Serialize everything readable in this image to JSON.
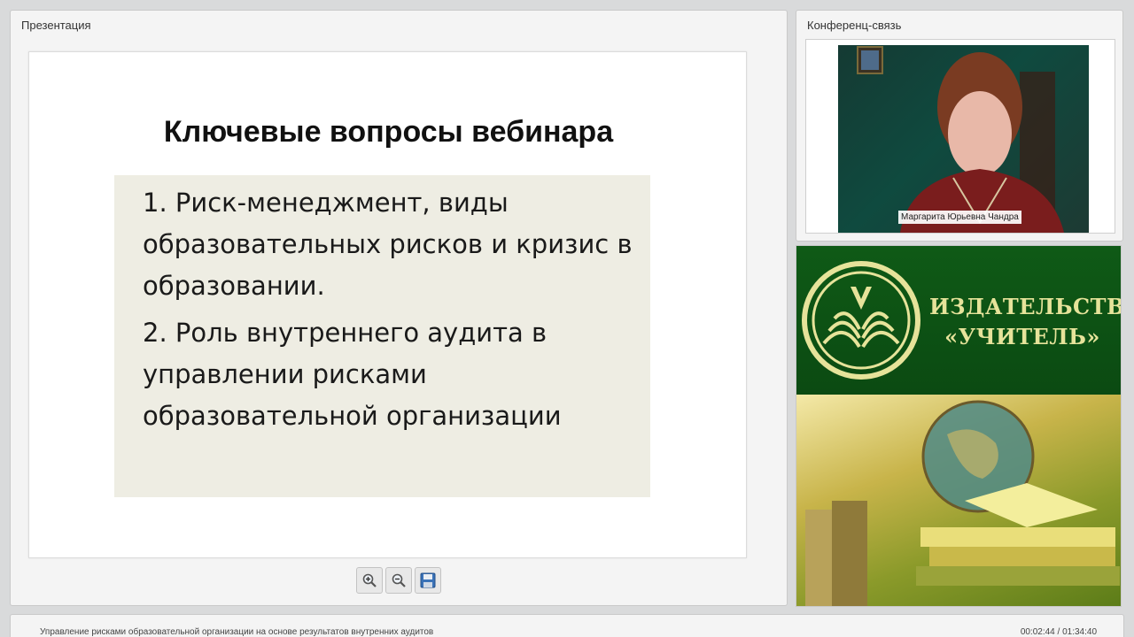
{
  "presentation": {
    "panel_title": "Презентация",
    "slide": {
      "title": "Ключевые вопросы вебинара",
      "items": [
        "1. Риск-менеджмент, виды образовательных рисков и кризис в образовании.",
        "2. Роль внутреннего аудита в управлении рисками образовательной организации"
      ]
    },
    "toolbar": [
      {
        "icon": "zoom-in-icon"
      },
      {
        "icon": "zoom-out-icon"
      },
      {
        "icon": "save-icon"
      }
    ]
  },
  "conference": {
    "panel_title": "Конференц-связь",
    "speaker_name": "Маргарита Юрьевна Чандра"
  },
  "banner": {
    "line1": "ИЗДАТЕЛЬСТВО",
    "line2": "«УЧИТЕЛЬ»",
    "colors": {
      "green": "#0f5a16",
      "gold": "#e6e39a"
    }
  },
  "footer": {
    "title": "Управление рисками образовательной организации на основе результатов внутренних аудитов",
    "time": "00:02:44 / 01:34:40"
  }
}
